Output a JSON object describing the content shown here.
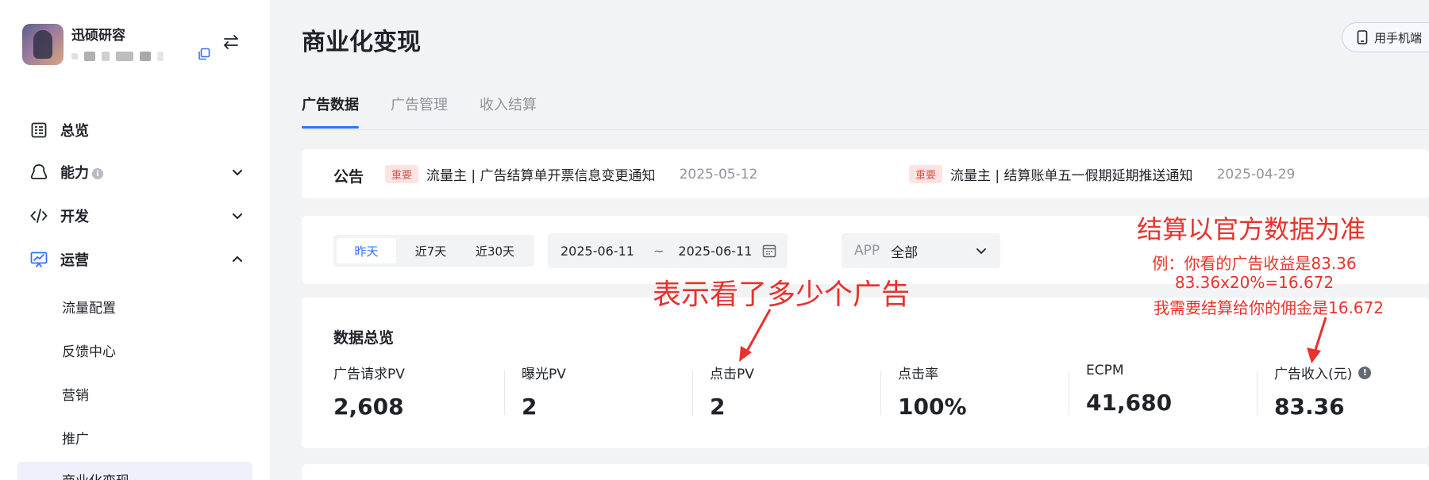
{
  "sidebar": {
    "profile_name": "迅硕研容",
    "nav": [
      {
        "label": "总览"
      },
      {
        "label": "能力",
        "info": "i"
      },
      {
        "label": "开发"
      },
      {
        "label": "运营"
      }
    ],
    "sub_items": [
      "流量配置",
      "反馈中心",
      "营销",
      "推广",
      "商业化变现"
    ]
  },
  "header": {
    "title": "商业化变现",
    "mobile_button": "用手机端"
  },
  "tabs": [
    "广告数据",
    "广告管理",
    "收入结算"
  ],
  "notice": {
    "title": "公告",
    "items": [
      {
        "tag": "重要",
        "text": "流量主 | 广告结算单开票信息变更通知",
        "date": "2025-05-12"
      },
      {
        "tag": "重要",
        "text": "流量主 | 结算账单五一假期延期推送通知",
        "date": "2025-04-29"
      }
    ]
  },
  "filter": {
    "ranges": [
      "昨天",
      "近7天",
      "近30天"
    ],
    "active_range": "昨天",
    "start_date": "2025-06-11",
    "separator": "~",
    "end_date": "2025-06-11",
    "app_label": "APP",
    "app_value": "全部"
  },
  "overview": {
    "title": "数据总览",
    "metrics": [
      {
        "label": "广告请求PV",
        "value": "2,608"
      },
      {
        "label": "曝光PV",
        "value": "2"
      },
      {
        "label": "点击PV",
        "value": "2"
      },
      {
        "label": "点击率",
        "value": "100%"
      },
      {
        "label": "ECPM",
        "value": "41,680"
      },
      {
        "label": "广告收入(元)",
        "value": "83.36",
        "warn": "!"
      }
    ]
  },
  "annotations": {
    "click_note": "表示看了多少个广告",
    "settle_title": "结算以官方数据为准",
    "settle_line1": "例：你看的广告收益是83.36",
    "settle_line2": "83.36x20%=16.672",
    "settle_line3": "我需要结算给你的佣金是16.672"
  },
  "colors": {
    "accent": "#3370ff",
    "annotation": "#e8322d",
    "tag_bg": "#fde4e2",
    "tag_text": "#e1534a"
  }
}
